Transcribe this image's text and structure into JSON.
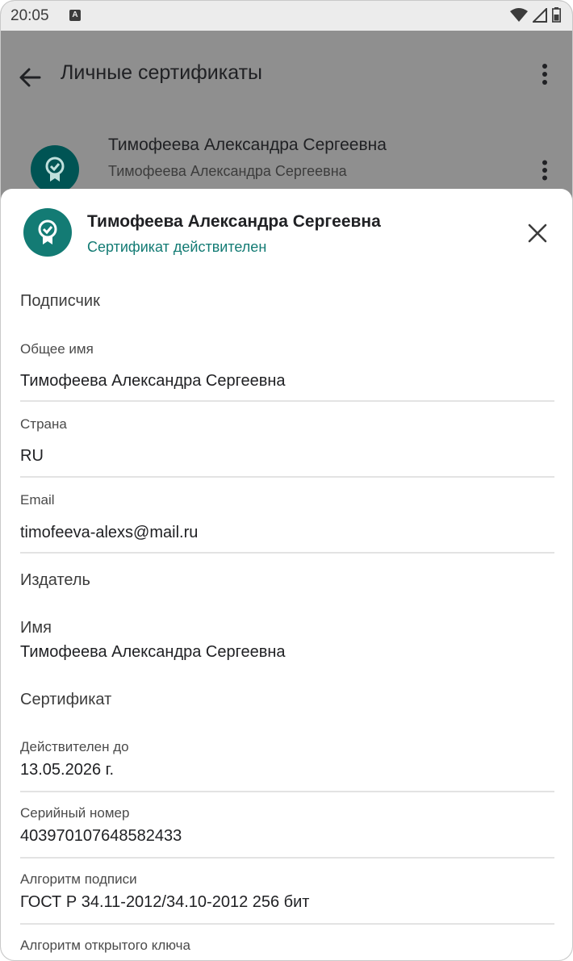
{
  "status_bar": {
    "time": "20:05",
    "app_icon": "A"
  },
  "app_bar": {
    "title": "Личные сертификаты"
  },
  "list": {
    "items": [
      {
        "title": "Тимофеева Александра Сергеевна",
        "subtitle": "Тимофеева Александра Сергеевна"
      }
    ]
  },
  "sheet": {
    "title": "Тимофеева Александра Сергеевна",
    "status": "Сертификат действителен",
    "subscriber": {
      "heading": "Подписчик",
      "common_name_label": "Общее имя",
      "common_name": "Тимофеева Александра Сергеевна",
      "country_label": "Страна",
      "country": "RU",
      "email_label": "Email",
      "email": "timofeeva-alexs@mail.ru"
    },
    "issuer": {
      "heading": "Издатель",
      "name_label": "Имя",
      "name": "Тимофеева Александра Сергеевна"
    },
    "certificate": {
      "heading": "Сертификат",
      "valid_until_label": "Действителен до",
      "valid_until": "13.05.2026 г.",
      "serial_label": "Серийный номер",
      "serial": "403970107648582433",
      "sig_alg_label": "Алгоритм подписи",
      "sig_alg": "ГОСТ Р 34.11-2012/34.10-2012 256 бит",
      "pubkey_alg_label": "Алгоритм открытого ключа"
    }
  },
  "colors": {
    "accent": "#137b74",
    "scrim": "#8f8f8f"
  }
}
